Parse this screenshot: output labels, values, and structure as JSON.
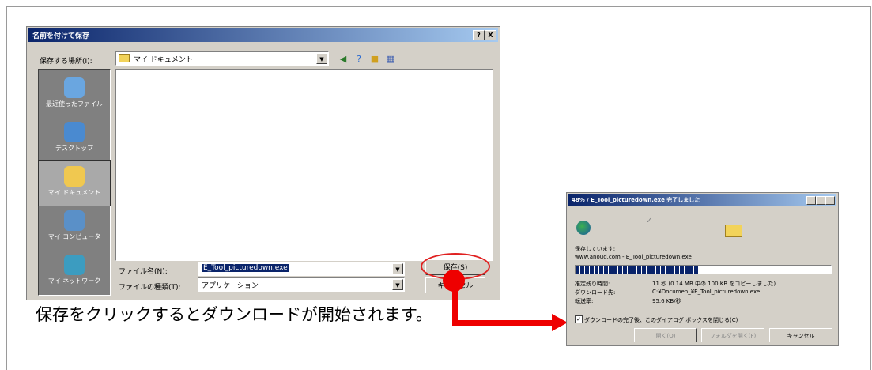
{
  "save_dialog": {
    "title": "名前を付けて保存",
    "help_btn": "?",
    "close_btn": "X",
    "save_in_label": "保存する場所(I):",
    "save_in_value": "マイ ドキュメント",
    "places": [
      "最近使ったファイル",
      "デスクトップ",
      "マイ ドキュメント",
      "マイ コンピュータ",
      "マイ ネットワーク"
    ],
    "filename_label": "ファイル名(N):",
    "filename_value": "E_Tool_picturedown.exe",
    "filetype_label": "ファイルの種類(T):",
    "filetype_value": "アプリケーション",
    "save_button": "保存(S)",
    "cancel_button": "キャンセル"
  },
  "caption": "保存をクリックするとダウンロードが開始されます。",
  "progress_dialog": {
    "title": "48% / E_Tool_picturedown.exe 完了しました",
    "status": "保存しています:",
    "source": "www.anoud.com - E_Tool_picturedown.exe",
    "progress": 0.48,
    "rows": [
      {
        "label": "推定残り時間:",
        "value": "11 秒 (0.14 MB 中の 100 KB をコピーしました)"
      },
      {
        "label": "ダウンロード先:",
        "value": "C:¥Documen_¥E_Tool_picturedown.exe"
      },
      {
        "label": "転送率:",
        "value": "95.6 KB/秒"
      }
    ],
    "checkbox_label": "ダウンロードの完了後、このダイアログ ボックスを閉じる(C)",
    "buttons": [
      "開く(O)",
      "フォルダを開く(F)",
      "キャンセル"
    ]
  },
  "colors": {
    "accent": "#ee0000",
    "titlebar": "#0a246a"
  }
}
